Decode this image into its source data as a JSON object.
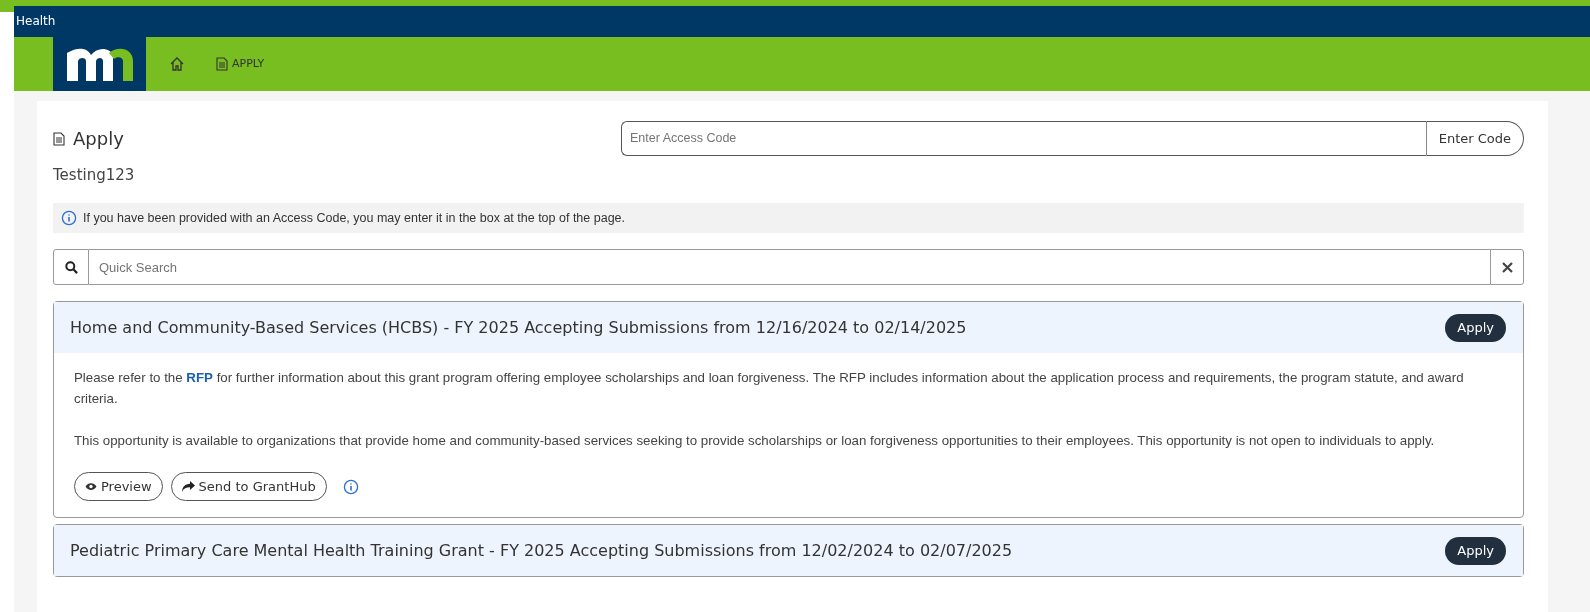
{
  "top_bar": {
    "title": "Health"
  },
  "nav": {
    "items": [
      {
        "kind": "home"
      },
      {
        "kind": "apply",
        "label": "APPLY"
      }
    ]
  },
  "page": {
    "title": "Apply",
    "subtitle": "Testing123",
    "access_code": {
      "placeholder": "Enter Access Code",
      "button": "Enter Code"
    },
    "info": "If you have been provided with an Access Code, you may enter it in the box at the top of the page.",
    "search": {
      "placeholder": "Quick Search"
    }
  },
  "opportunities": [
    {
      "title": "Home and Community-Based Services (HCBS) - FY 2025 Accepting Submissions from 12/16/2024 to 02/14/2025",
      "button": "Apply",
      "paragraphs": [
        {
          "before": "Please refer to the ",
          "link": "RFP",
          "after": " for further information about this grant program offering employee scholarships and loan forgiveness. The RFP includes information about the application process and requirements, the program statute, and award criteria."
        },
        {
          "before": "This opportunity is available to organizations that provide home and community-based services seeking to provide scholarships or loan forgiveness opportunities to their employees. This opportunity is not open to individuals to apply."
        }
      ],
      "actions": [
        {
          "kind": "preview",
          "label": "Preview"
        },
        {
          "kind": "send",
          "label": "Send to GrantHub"
        }
      ]
    },
    {
      "title": "Pediatric Primary Care Mental Health Training Grant - FY 2025 Accepting Submissions from 12/02/2024 to 02/07/2025",
      "button": "Apply"
    }
  ]
}
